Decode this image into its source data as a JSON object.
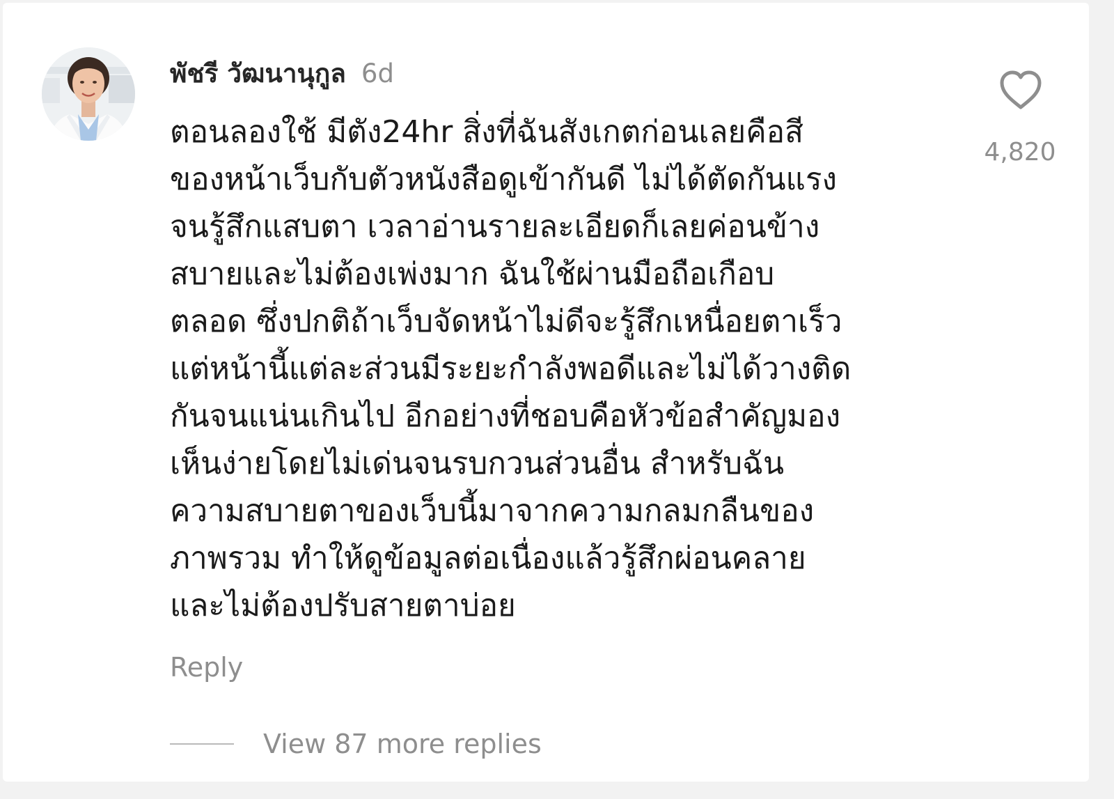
{
  "comment": {
    "username": "พัชรี วัฒนานุกูล",
    "timestamp": "6d",
    "lines": [
      "ตอนลองใช้ มีตัง24hr  สิ่งที่ฉันสังเกตก่อนเลยคือสี",
      "ของหน้าเว็บกับตัวหนังสือดูเข้ากันดี ไม่ได้ตัดกันแรง",
      "จนรู้สึกแสบตา เวลาอ่านรายละเอียดก็เลยค่อนข้าง",
      "สบายและไม่ต้องเพ่งมาก ฉันใช้ผ่านมือถือเกือบ",
      "ตลอด ซึ่งปกติถ้าเว็บจัดหน้าไม่ดีจะรู้สึกเหนื่อยตาเร็ว",
      "แต่หน้านี้แต่ละส่วนมีระยะกำลังพอดีและไม่ได้วางติด",
      "กันจนแน่นเกินไป อีกอย่างที่ชอบคือหัวข้อสำคัญมอง",
      "เห็นง่ายโดยไม่เด่นจนรบกวนส่วนอื่น สำหรับฉัน",
      "ความสบายตาของเว็บนี้มาจากความกลมกลืนของ",
      "ภาพรวม ทำให้ดูข้อมูลต่อเนื่องแล้วรู้สึกผ่อนคลาย",
      "และไม่ต้องปรับสายตาบ่อย"
    ],
    "like_icon": "heart-outline-icon",
    "like_count": "4,820",
    "reply_label": "Reply",
    "view_replies_label": "View 87 more replies"
  },
  "colors": {
    "text_primary": "#262626",
    "text_secondary": "#8e8e8e",
    "background": "#ffffff"
  }
}
